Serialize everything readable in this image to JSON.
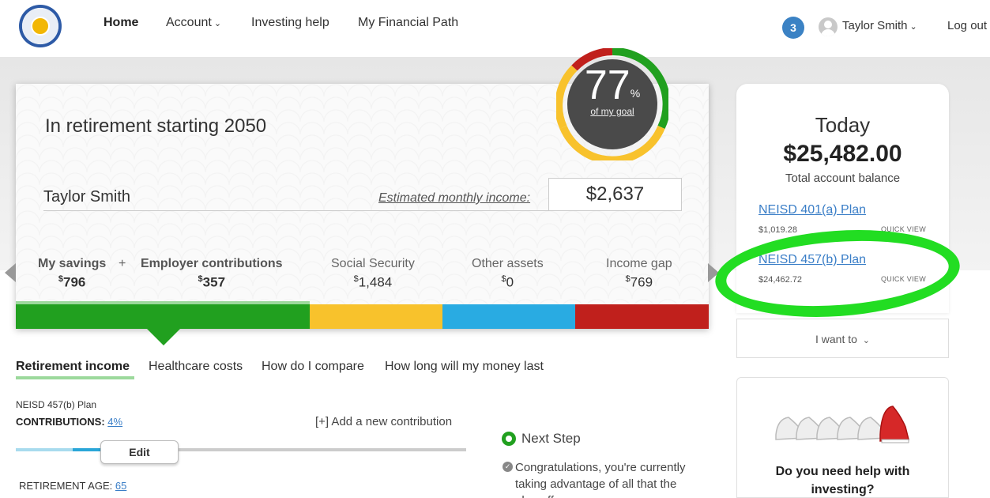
{
  "nav": {
    "home": "Home",
    "account": "Account",
    "investing_help": "Investing help",
    "financial_path": "My Financial Path",
    "notification_count": "3",
    "user_name": "Taylor Smith",
    "logout": "Log out"
  },
  "card": {
    "title": "In retirement starting 2050",
    "name": "Taylor Smith",
    "est_label": "Estimated monthly income:",
    "est_value": "$2,637",
    "goal_percent": "77",
    "goal_percent_sign": "%",
    "goal_sub": "of my goal",
    "plus": "+",
    "segments": [
      {
        "label": "My savings",
        "currency": "$",
        "value": "796"
      },
      {
        "label": "Employer contributions",
        "currency": "$",
        "value": "357"
      },
      {
        "label": "Social Security",
        "currency": "$",
        "value": "1,484"
      },
      {
        "label": "Other assets",
        "currency": "$",
        "value": "0"
      },
      {
        "label": "Income gap",
        "currency": "$",
        "value": "769"
      }
    ],
    "colors": {
      "green": "#21a01f",
      "yellow": "#f8c22c",
      "blue": "#29abe2",
      "red": "#c0201c"
    }
  },
  "right": {
    "today_label": "Today",
    "today_amount": "$25,482.00",
    "today_sub": "Total account balance",
    "plans": [
      {
        "name": "NEISD 401(a) Plan",
        "amount": "$1,019.28",
        "quick": "QUICK VIEW"
      },
      {
        "name": "NEISD 457(b) Plan",
        "amount": "$24,462.72",
        "quick": "QUICK VIEW"
      }
    ],
    "i_want_to": "I want to",
    "help_text": "Do you need help with investing?"
  },
  "tabs": [
    "Retirement income",
    "Healthcare costs",
    "How do I compare",
    "How long will my money last"
  ],
  "lower": {
    "plan_name": "NEISD 457(b) Plan",
    "contrib_label": "CONTRIBUTIONS:",
    "contrib_value": "4%",
    "add_contrib": "[+] Add a new contribution",
    "edit": "Edit",
    "ret_age_label": "RETIREMENT AGE:",
    "ret_age_value": "65",
    "next_step": "Next Step",
    "congrats": "Congratulations, you're currently taking advantage of all that the plan offers"
  }
}
